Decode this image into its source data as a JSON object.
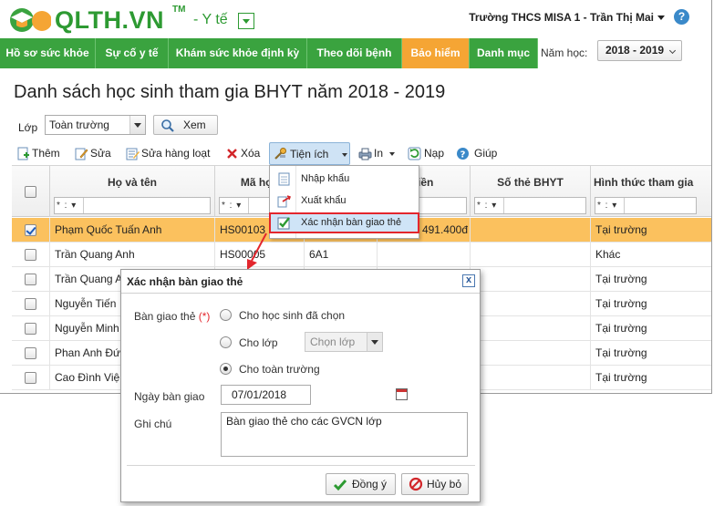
{
  "header": {
    "logo_text": "QLTH.VN",
    "logo_tm": "TM",
    "module": "- Y tế",
    "user": "Trường THCS MISA 1 - Trần Thị Mai",
    "help": "?"
  },
  "nav": {
    "items": [
      {
        "label": "Hồ sơ sức khỏe"
      },
      {
        "label": "Sự cố y tế"
      },
      {
        "label": "Khám sức khỏe định kỳ"
      },
      {
        "label": "Theo dõi bệnh"
      },
      {
        "label": "Bảo hiểm"
      },
      {
        "label": "Danh mục"
      }
    ],
    "year_label": "Năm học:",
    "year_value": "2018 - 2019"
  },
  "page": {
    "title": "Danh sách học sinh tham gia BHYT năm 2018 - 2019",
    "filter_label": "Lớp",
    "filter_value": "Toàn trường",
    "view_button": "Xem"
  },
  "toolbar": {
    "add": "Thêm",
    "edit": "Sửa",
    "bulk_edit": "Sửa hàng loạt",
    "delete": "Xóa",
    "utilities": "Tiện ích",
    "print": "In",
    "load": "Nạp",
    "help": "Giúp"
  },
  "menu": {
    "items": [
      {
        "label": "Nhập khẩu"
      },
      {
        "label": "Xuất khẩu"
      },
      {
        "label": "Xác nhận bàn giao thẻ"
      }
    ]
  },
  "grid": {
    "columns": [
      "Họ và tên",
      "Mã học",
      "",
      "tiền",
      "Số thẻ BHYT",
      "Hình thức tham gia"
    ],
    "filter_op": "* : ▾",
    "rows": [
      {
        "checked": true,
        "name": "Phạm Quốc Tuấn Anh",
        "code": "HS00103",
        "class": "",
        "amount": "491.400đ",
        "card": "",
        "form": "Tại trường"
      },
      {
        "checked": false,
        "name": "Trần Quang Anh",
        "code": "HS00005",
        "class": "6A1",
        "amount": "",
        "card": "",
        "form": "Khác"
      },
      {
        "checked": false,
        "name": "Trần Quang A",
        "code": "",
        "class": "",
        "amount": "",
        "card": "",
        "form": "Tại trường"
      },
      {
        "checked": false,
        "name": "Nguyễn Tiến",
        "code": "",
        "class": "",
        "amount": "",
        "card": "",
        "form": "Tại trường"
      },
      {
        "checked": false,
        "name": "Nguyễn Minh",
        "code": "",
        "class": "",
        "amount": "",
        "card": "",
        "form": "Tại trường"
      },
      {
        "checked": false,
        "name": "Phan Anh Đứ",
        "code": "",
        "class": "",
        "amount": "",
        "card": "",
        "form": "Tại trường"
      },
      {
        "checked": false,
        "name": "Cao Đình Việ",
        "code": "",
        "class": "",
        "amount": "",
        "card": "",
        "form": "Tại trường"
      }
    ]
  },
  "dialog": {
    "title": "Xác nhận bàn giao thẻ",
    "close": "x",
    "handover_label": "Bàn giao thẻ",
    "required_mark": "(*)",
    "option_selected": "Cho học sinh đã chọn",
    "option_class": "Cho lớp",
    "class_placeholder": "Chọn lớp",
    "option_school": "Cho toàn trường",
    "date_label": "Ngày bàn giao",
    "date_value": "07/01/2018",
    "note_label": "Ghi chú",
    "note_value": "Bàn giao thẻ cho các GVCN lớp",
    "ok": "Đồng ý",
    "cancel": "Hủy bỏ"
  },
  "colors": {
    "brand_green": "#3aa33f",
    "active_tab": "#f5a534",
    "selected_row": "#fbc15e",
    "highlight_border": "#e3262d"
  }
}
